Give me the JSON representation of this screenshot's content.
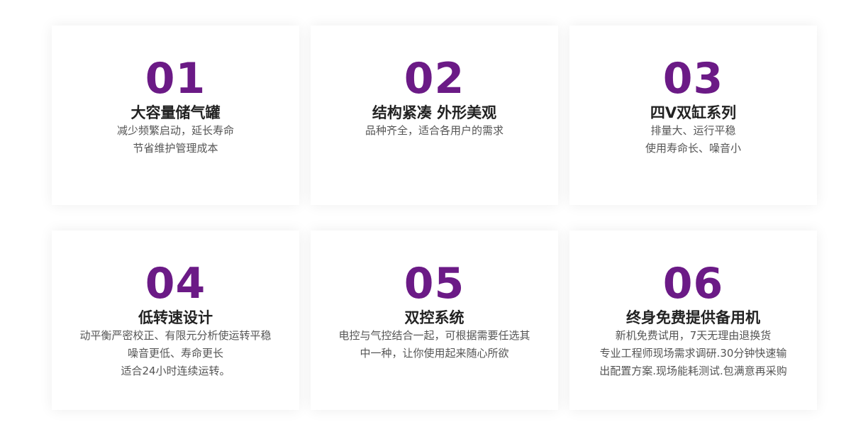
{
  "accent_color": "#6b1a86",
  "cards": [
    {
      "number": "01",
      "title": "大容量储气罐",
      "lines": [
        "减少频繁启动，延长寿命",
        "节省维护管理成本"
      ]
    },
    {
      "number": "02",
      "title": "结构紧凑 外形美观",
      "lines": [
        "品种齐全，适合各用户的需求"
      ]
    },
    {
      "number": "03",
      "title": "四V双缸系列",
      "lines": [
        "排量大、运行平稳",
        "使用寿命长、噪音小"
      ]
    },
    {
      "number": "04",
      "title": "低转速设计",
      "lines": [
        "动平衡严密校正、有限元分析使运转平稳",
        "噪音更低、寿命更长",
        "适合24小时连续运转。"
      ]
    },
    {
      "number": "05",
      "title": "双控系统",
      "lines": [
        "电控与气控结合一起，可根据需要任选其",
        "中一种，让你使用起来随心所欲"
      ]
    },
    {
      "number": "06",
      "title": "终身免费提供备用机",
      "lines": [
        "新机免费试用，7天无理由退换货",
        "专业工程师现场需求调研.30分钟快速输",
        "出配置方案.现场能耗测试.包满意再采购"
      ]
    }
  ]
}
